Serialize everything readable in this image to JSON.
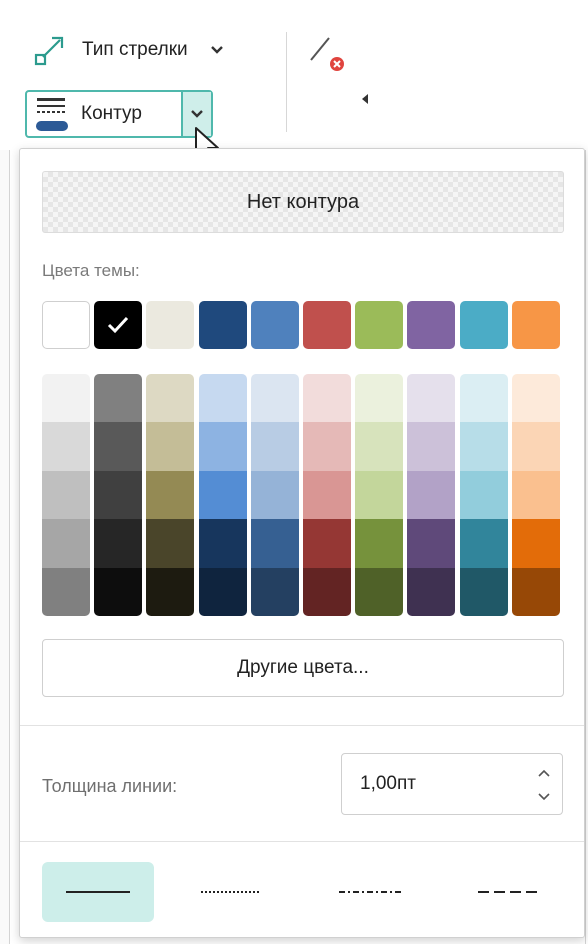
{
  "toolbar": {
    "arrow_type_label": "Тип стрелки",
    "contour_label": "Контур",
    "icons": [
      "arrow-type-icon",
      "chevron-down-icon",
      "no-arrow-icon",
      "contour-icon",
      "mouse-cursor-icon"
    ]
  },
  "panel": {
    "no_contour_label": "Нет контура",
    "theme_colors_label": "Цвета темы:",
    "theme_colors": [
      "#FFFFFF",
      "#000000",
      "#EBE9DF",
      "#1F497D",
      "#4F81BD",
      "#C0504D",
      "#9BBB59",
      "#8064A2",
      "#4BACC6",
      "#F79646"
    ],
    "selected_theme_color": "#000000",
    "shades": [
      [
        "#F2F2F2",
        "#D9D9D9",
        "#BFBFBF",
        "#A6A6A6",
        "#808080"
      ],
      [
        "#808080",
        "#595959",
        "#404040",
        "#262626",
        "#0D0D0D"
      ],
      [
        "#DDD9C3",
        "#C4BD97",
        "#948A54",
        "#4A452A",
        "#1D1B10"
      ],
      [
        "#C6D9F0",
        "#8DB3E2",
        "#548DD4",
        "#17365D",
        "#0F243E"
      ],
      [
        "#DBE5F1",
        "#B8CCE4",
        "#95B3D7",
        "#366092",
        "#244061"
      ],
      [
        "#F2DCDB",
        "#E5B9B7",
        "#D99694",
        "#953734",
        "#632423"
      ],
      [
        "#EBF1DD",
        "#D7E3BC",
        "#C3D69B",
        "#76923C",
        "#4F6128"
      ],
      [
        "#E5E0EC",
        "#CCC1D9",
        "#B2A2C7",
        "#5F497A",
        "#3F3151"
      ],
      [
        "#DBEEF3",
        "#B7DDE8",
        "#92CDDC",
        "#31859B",
        "#205867"
      ],
      [
        "#FDEADA",
        "#FBD5B5",
        "#FAC08F",
        "#E36C09",
        "#974806"
      ]
    ],
    "other_colors_label": "Другие цвета...",
    "line_thickness_label": "Толщина линии:",
    "line_thickness_value": "1,00пт",
    "line_styles": [
      "solid",
      "dotted",
      "dash-dot",
      "dashed"
    ],
    "selected_line_style": "solid",
    "accent_color": "#4FB8AC"
  }
}
